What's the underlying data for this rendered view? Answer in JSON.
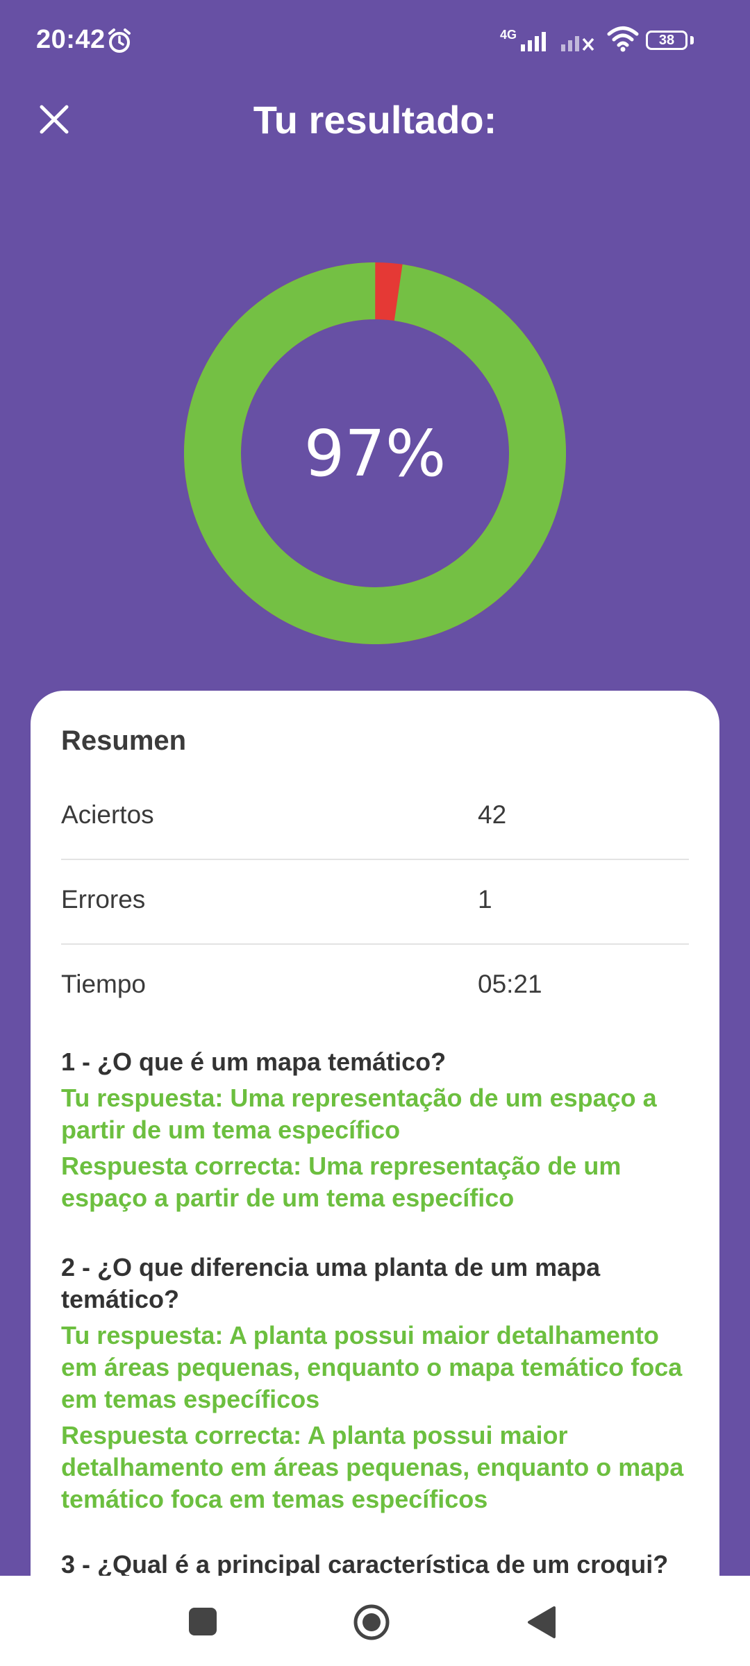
{
  "status_bar": {
    "time": "20:42",
    "network": "4G",
    "battery": "38"
  },
  "header": {
    "title": "Tu resultado:"
  },
  "result": {
    "percent_label": "97%",
    "correct_fraction": 0.977,
    "colors": {
      "correct": "#74C044",
      "error": "#E53935"
    }
  },
  "summary": {
    "title": "Resumen",
    "rows": [
      {
        "label": "Aciertos",
        "value": "42"
      },
      {
        "label": "Errores",
        "value": "1"
      },
      {
        "label": "Tiempo",
        "value": "05:21"
      }
    ]
  },
  "questions": [
    {
      "question": "1 - ¿O que é um mapa temático?",
      "your_answer": "Tu respuesta: Uma representação de um espaço a partir de um tema específico",
      "correct_answer": "Respuesta correcta: Uma representação de um espaço a partir de um tema específico"
    },
    {
      "question": "2 - ¿O que diferencia uma planta de um mapa temático?",
      "your_answer": "Tu respuesta: A planta possui maior detalhamento em áreas pequenas, enquanto o mapa temático foca em temas específicos",
      "correct_answer": "Respuesta correcta: A planta possui maior detalhamento em áreas pequenas, enquanto o mapa temático foca em temas específicos"
    },
    {
      "question": "3 - ¿Qual é a principal característica de um croqui?"
    }
  ]
}
